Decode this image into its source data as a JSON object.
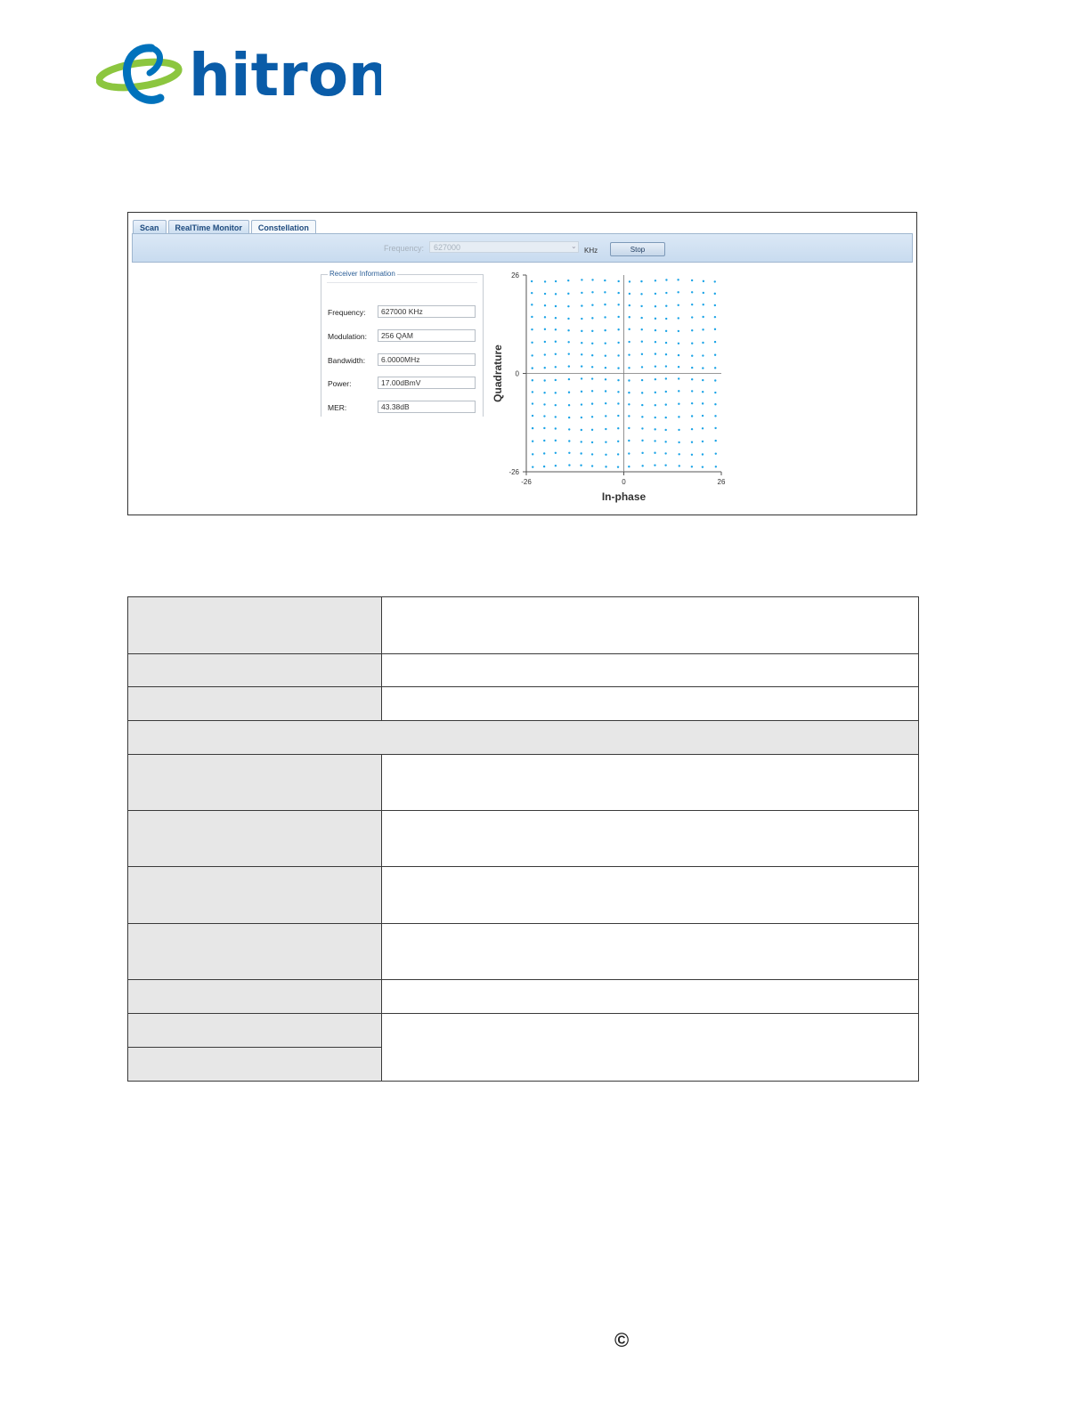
{
  "brand": {
    "name": "hitron"
  },
  "tabs": [
    {
      "label": "Scan"
    },
    {
      "label": "RealTime Monitor"
    },
    {
      "label": "Constellation",
      "active": true
    }
  ],
  "toolbar": {
    "frequency_label": "Frequency:",
    "frequency_value": "627000",
    "unit": "KHz",
    "stop_label": "Stop"
  },
  "receiver": {
    "legend": "Receiver Information",
    "fields": [
      {
        "label": "Frequency:",
        "value": "627000 KHz"
      },
      {
        "label": "Modulation:",
        "value": "256 QAM"
      },
      {
        "label": "Bandwidth:",
        "value": "6.0000MHz"
      },
      {
        "label": "Power:",
        "value": "17.00dBmV"
      },
      {
        "label": "MER:",
        "value": "43.38dB"
      }
    ]
  },
  "chart_data": {
    "type": "scatter",
    "title": "",
    "xlabel": "In-phase",
    "ylabel": "Quadrature",
    "xlim": [
      -26,
      26
    ],
    "ylim": [
      -26,
      26
    ],
    "xticks": [
      "-26",
      "0",
      "26"
    ],
    "yticks": [
      "26",
      "0",
      "-26"
    ],
    "grid": false,
    "series": [
      {
        "description": "256-QAM constellation points, 16 x 16 grid at odd values -15 to 15 on both axes",
        "levels": [
          -15,
          -13,
          -11,
          -9,
          -7,
          -5,
          -3,
          -1,
          1,
          3,
          5,
          7,
          9,
          11,
          13,
          15
        ]
      }
    ],
    "point_color": "#1aa3e6"
  },
  "table": {
    "rows": 13,
    "colors": {
      "label_cell": "#e7e7e7",
      "border": "#3a3a3a"
    }
  },
  "footer": {
    "copyright_symbol": "©"
  }
}
